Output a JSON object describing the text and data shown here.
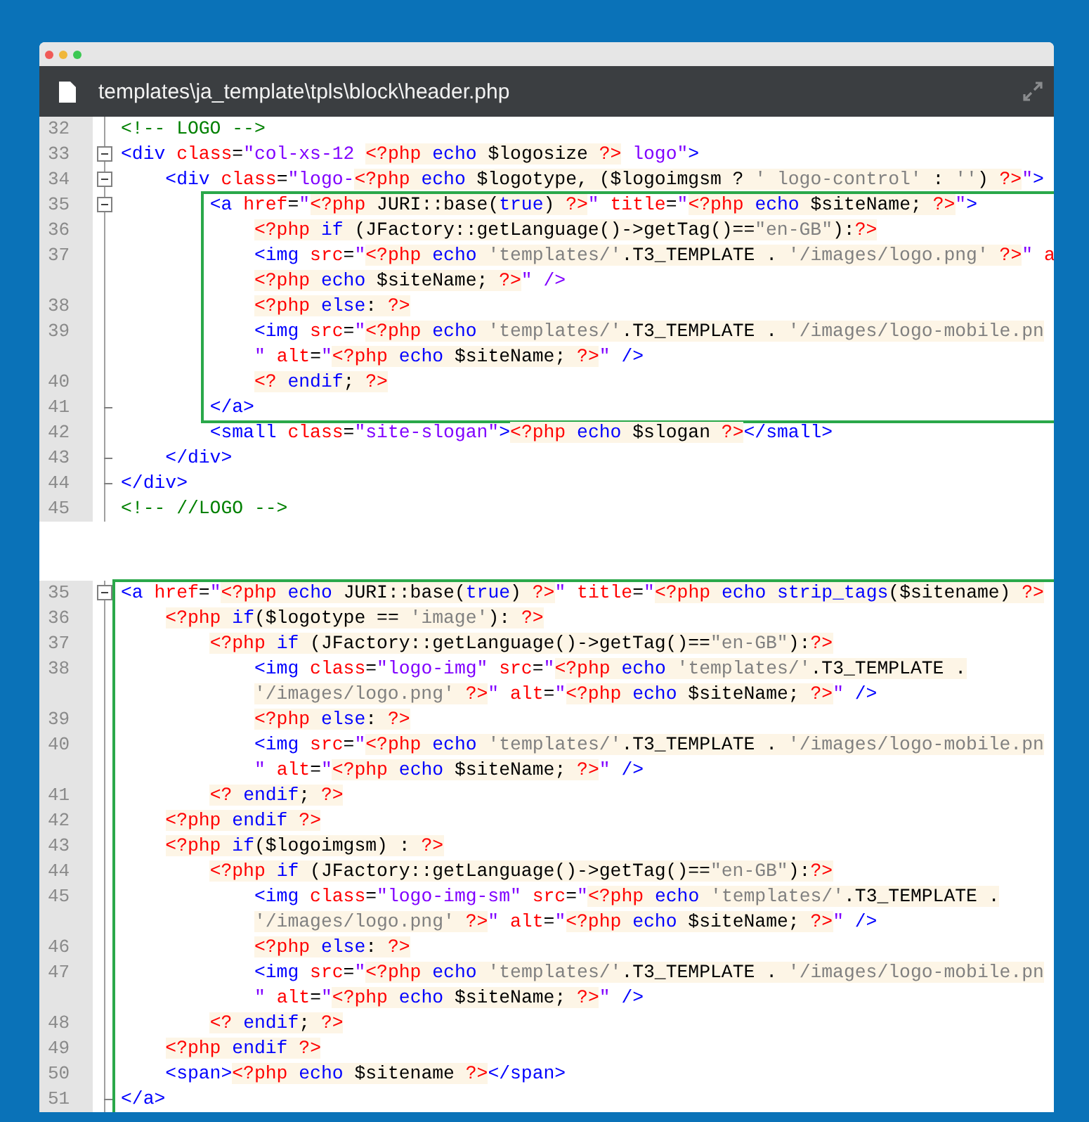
{
  "window": {
    "title": "templates\\ja_template\\tpls\\block\\header.php"
  },
  "panels": [
    {
      "lines": [
        {
          "n": "32",
          "fold_start": false,
          "fold_end": false,
          "highlighted": false,
          "text": "<!-- LOGO -->"
        },
        {
          "n": "33",
          "fold_start": true,
          "fold_end": false,
          "highlighted": false,
          "text": "<div class=\"col-xs-12 <?php echo $logosize ?> logo\">"
        },
        {
          "n": "34",
          "fold_start": true,
          "fold_end": false,
          "highlighted": false,
          "text": "    <div class=\"logo-<?php echo $logotype, ($logoimgsm ? ' logo-control' : '') ?>\">"
        },
        {
          "n": "35",
          "fold_start": true,
          "fold_end": false,
          "highlighted": true,
          "text": "        <a href=\"<?php JURI::base(true) ?>\" title=\"<?php echo $siteName; ?>\">"
        },
        {
          "n": "36",
          "fold_start": false,
          "fold_end": false,
          "highlighted": true,
          "text": "            <?php if (JFactory::getLanguage()->getTag()==\"en-GB\"):?>"
        },
        {
          "n": "37",
          "fold_start": false,
          "fold_end": false,
          "highlighted": true,
          "text": "            <img src=\"<?php echo 'templates/'.T3_TEMPLATE . '/images/logo.png' ?>\" a"
        },
        {
          "fold_start": false,
          "fold_end": false,
          "highlighted": true,
          "text": "            <?php echo $siteName; ?>\" />"
        },
        {
          "n": "38",
          "fold_start": false,
          "fold_end": false,
          "highlighted": true,
          "text": "            <?php else: ?>"
        },
        {
          "n": "39",
          "fold_start": false,
          "fold_end": false,
          "highlighted": true,
          "text": "            <img src=\"<?php echo 'templates/'.T3_TEMPLATE . '/images/logo-mobile.pn"
        },
        {
          "fold_start": false,
          "fold_end": false,
          "highlighted": true,
          "text": "            \" alt=\"<?php echo $siteName; ?>\" />"
        },
        {
          "n": "40",
          "fold_start": false,
          "fold_end": false,
          "highlighted": true,
          "text": "            <? endif; ?>"
        },
        {
          "n": "41",
          "fold_start": false,
          "fold_end": true,
          "highlighted": true,
          "text": "        </a>"
        },
        {
          "n": "42",
          "fold_start": false,
          "fold_end": false,
          "highlighted": false,
          "text": "        <small class=\"site-slogan\"><?php echo $slogan ?></small>"
        },
        {
          "n": "43",
          "fold_start": false,
          "fold_end": true,
          "highlighted": false,
          "text": "    </div>"
        },
        {
          "n": "44",
          "fold_start": false,
          "fold_end": true,
          "highlighted": false,
          "text": "</div>"
        },
        {
          "n": "45",
          "fold_start": false,
          "fold_end": false,
          "highlighted": false,
          "text": "<!-- //LOGO -->"
        }
      ]
    },
    {
      "lines": [
        {
          "n": "35",
          "fold_start": true,
          "fold_end": false,
          "highlighted": true,
          "text": "<a href=\"<?php echo JURI::base(true) ?>\" title=\"<?php echo strip_tags($sitename) ?>"
        },
        {
          "n": "36",
          "fold_start": false,
          "fold_end": false,
          "highlighted": true,
          "text": "    <?php if($logotype == 'image'): ?>"
        },
        {
          "n": "37",
          "fold_start": false,
          "fold_end": false,
          "highlighted": true,
          "text": "        <?php if (JFactory::getLanguage()->getTag()==\"en-GB\"):?>"
        },
        {
          "n": "38",
          "fold_start": false,
          "fold_end": false,
          "highlighted": true,
          "text": "            <img class=\"logo-img\" src=\"<?php echo 'templates/'.T3_TEMPLATE ."
        },
        {
          "fold_start": false,
          "fold_end": false,
          "highlighted": true,
          "text": "            '/images/logo.png' ?>\" alt=\"<?php echo $siteName; ?>\" />"
        },
        {
          "n": "39",
          "fold_start": false,
          "fold_end": false,
          "highlighted": true,
          "text": "            <?php else: ?>"
        },
        {
          "n": "40",
          "fold_start": false,
          "fold_end": false,
          "highlighted": true,
          "text": "            <img src=\"<?php echo 'templates/'.T3_TEMPLATE . '/images/logo-mobile.pn"
        },
        {
          "fold_start": false,
          "fold_end": false,
          "highlighted": true,
          "text": "            \" alt=\"<?php echo $siteName; ?>\" />"
        },
        {
          "n": "41",
          "fold_start": false,
          "fold_end": false,
          "highlighted": true,
          "text": "        <? endif; ?>"
        },
        {
          "n": "42",
          "fold_start": false,
          "fold_end": false,
          "highlighted": true,
          "text": "    <?php endif ?>"
        },
        {
          "n": "43",
          "fold_start": false,
          "fold_end": false,
          "highlighted": true,
          "text": "    <?php if($logoimgsm) : ?>"
        },
        {
          "n": "44",
          "fold_start": false,
          "fold_end": false,
          "highlighted": true,
          "text": "        <?php if (JFactory::getLanguage()->getTag()==\"en-GB\"):?>"
        },
        {
          "n": "45",
          "fold_start": false,
          "fold_end": false,
          "highlighted": true,
          "text": "            <img class=\"logo-img-sm\" src=\"<?php echo 'templates/'.T3_TEMPLATE ."
        },
        {
          "fold_start": false,
          "fold_end": false,
          "highlighted": true,
          "text": "            '/images/logo.png' ?>\" alt=\"<?php echo $siteName; ?>\" />"
        },
        {
          "n": "46",
          "fold_start": false,
          "fold_end": false,
          "highlighted": true,
          "text": "            <?php else: ?>"
        },
        {
          "n": "47",
          "fold_start": false,
          "fold_end": false,
          "highlighted": true,
          "text": "            <img src=\"<?php echo 'templates/'.T3_TEMPLATE . '/images/logo-mobile.pn"
        },
        {
          "fold_start": false,
          "fold_end": false,
          "highlighted": true,
          "text": "            \" alt=\"<?php echo $siteName; ?>\" />"
        },
        {
          "n": "48",
          "fold_start": false,
          "fold_end": false,
          "highlighted": true,
          "text": "        <? endif; ?>"
        },
        {
          "n": "49",
          "fold_start": false,
          "fold_end": false,
          "highlighted": true,
          "text": "    <?php endif ?>"
        },
        {
          "n": "50",
          "fold_start": false,
          "fold_end": false,
          "highlighted": true,
          "text": "    <span><?php echo $sitename ?></span>"
        },
        {
          "n": "51",
          "fold_start": false,
          "fold_end": true,
          "highlighted": true,
          "text": "</a>"
        }
      ]
    }
  ]
}
